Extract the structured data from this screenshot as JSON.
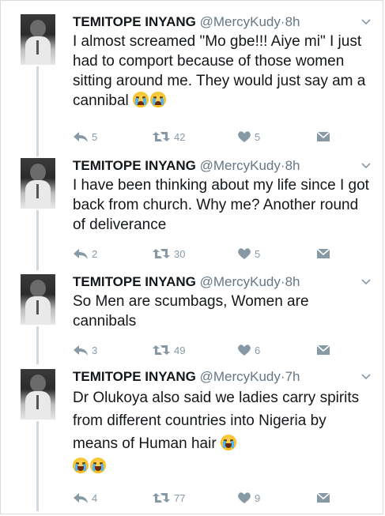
{
  "tweets": [
    {
      "name": "TEMITOPE INYANG",
      "handle": "@MercyKudy",
      "separator": "·",
      "time": "8h",
      "text": "I almost screamed \"Mo gbe!!! Aiye mi\" I just had to comport because of those women sitting around me. They would just say am a cannibal",
      "emojis": [
        "crying-face-emoji",
        "crying-face-emoji"
      ],
      "replies": "5",
      "retweets": "42",
      "likes": "5"
    },
    {
      "name": "TEMITOPE INYANG",
      "handle": "@MercyKudy",
      "separator": "·",
      "time": "8h",
      "text": "I have been thinking about my life since I got back from church. Why me? Another round of deliverance",
      "emojis": [],
      "replies": "2",
      "retweets": "30",
      "likes": "5"
    },
    {
      "name": "TEMITOPE INYANG",
      "handle": "@MercyKudy",
      "separator": "·",
      "time": "8h",
      "text": "So Men are scumbags, Women are cannibals",
      "emojis": [],
      "replies": "3",
      "retweets": "49",
      "likes": "6"
    },
    {
      "name": "TEMITOPE INYANG",
      "handle": "@MercyKudy",
      "separator": "·",
      "time": "7h",
      "text": "Dr Olukoya also said we ladies carry spirits from different countries into Nigeria by means of Human hair",
      "emojis": [
        "tears-of-joy-emoji",
        "tears-of-joy-emoji",
        "tears-of-joy-emoji"
      ],
      "replies": "4",
      "retweets": "77",
      "likes": "9"
    }
  ],
  "icons": {
    "reply": "reply-icon",
    "retweet": "retweet-icon",
    "like": "heart-icon",
    "dm": "envelope-icon",
    "more": "chevron-down-icon"
  },
  "colors": {
    "text": "#14171a",
    "secondary": "#657786",
    "icon": "#8899a6",
    "thread_line": "#cfd8e0"
  }
}
